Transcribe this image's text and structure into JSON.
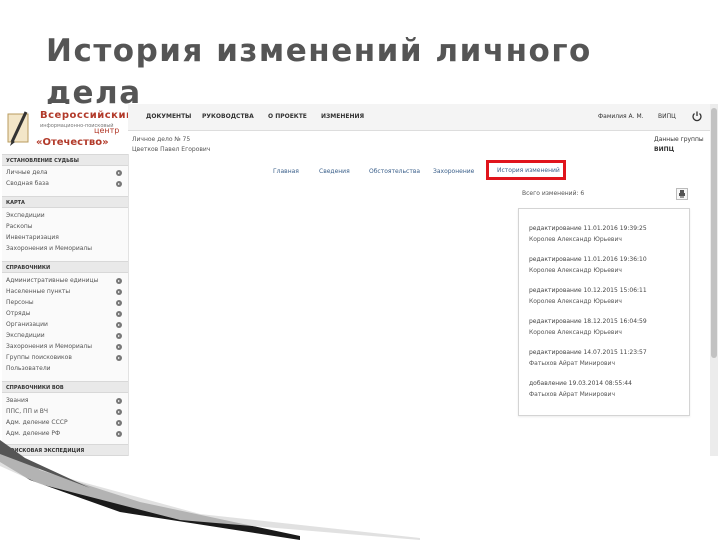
{
  "slide": {
    "title": "История изменений личного дела"
  },
  "logo": {
    "line1": "Всероссийский",
    "line2": "информационно-поисковый",
    "line3": "центр",
    "line4": "«Отечество»"
  },
  "topbar": {
    "nav": [
      "ДОКУМЕНТЫ",
      "РУКОВОДСТВА",
      "О ПРОЕКТЕ",
      "ИЗМЕНЕНИЯ"
    ],
    "user": "Фамилия А. М.",
    "org": "ВИПЦ"
  },
  "sidebar": {
    "sections": [
      {
        "title": "УСТАНОВЛЕНИЕ СУДЬБЫ",
        "items": [
          {
            "label": "Личные дела",
            "arrow": true
          },
          {
            "label": "Сводная база",
            "arrow": true
          }
        ]
      },
      {
        "title": "КАРТА",
        "items": [
          {
            "label": "Экспедиции",
            "arrow": false
          },
          {
            "label": "Раскопы",
            "arrow": false
          },
          {
            "label": "Инвентаризация",
            "arrow": false
          },
          {
            "label": "Захоронения и Мемориалы",
            "arrow": false
          }
        ]
      },
      {
        "title": "СПРАВОЧНИКИ",
        "items": [
          {
            "label": "Административные единицы",
            "arrow": true
          },
          {
            "label": "Населенные пункты",
            "arrow": true
          },
          {
            "label": "Персоны",
            "arrow": true
          },
          {
            "label": "Отряды",
            "arrow": true
          },
          {
            "label": "Организации",
            "arrow": true
          },
          {
            "label": "Экспедиции",
            "arrow": true
          },
          {
            "label": "Захоронения и Мемориалы",
            "arrow": true
          },
          {
            "label": "Группы поисковиков",
            "arrow": true
          },
          {
            "label": "Пользователи",
            "arrow": false
          }
        ]
      },
      {
        "title": "СПРАВОЧНИКИ ВОВ",
        "items": [
          {
            "label": "Звания",
            "arrow": true
          },
          {
            "label": "ППС, ПП и ВЧ",
            "arrow": true
          },
          {
            "label": "Адм. деление СССР",
            "arrow": true
          },
          {
            "label": "Адм. деление РФ",
            "arrow": true
          }
        ]
      },
      {
        "title": "ПОИСКОВАЯ ЭКСПЕДИЦИЯ",
        "items": []
      }
    ]
  },
  "case": {
    "number": "Личное дело № 75",
    "name": "Цветков Павел Егорович"
  },
  "right_info": {
    "line1": "Данные группы",
    "line2": "ВИПЦ"
  },
  "tabs": [
    "Главная",
    "Сведения",
    "Обстоятельства",
    "Захоронение",
    "История изменений"
  ],
  "active_tab": "История изменений",
  "history": {
    "title": "Всего изменений: 6",
    "entries": [
      {
        "action": "редактирование 11.01.2016 19:39:25",
        "who": "Королев Александр Юрьевич"
      },
      {
        "action": "редактирование 11.01.2016 19:36:10",
        "who": "Королев Александр Юрьевич"
      },
      {
        "action": "редактирование 10.12.2015 15:06:11",
        "who": "Королев Александр Юрьевич"
      },
      {
        "action": "редактирование 18.12.2015 16:04:59",
        "who": "Королев Александр Юрьевич"
      },
      {
        "action": "редактирование 14.07.2015 11:23:57",
        "who": "Фатыхов Айрат Минирович"
      },
      {
        "action": "добавление 19.03.2014 08:55:44",
        "who": "Фатыхов Айрат Минирович"
      }
    ]
  }
}
